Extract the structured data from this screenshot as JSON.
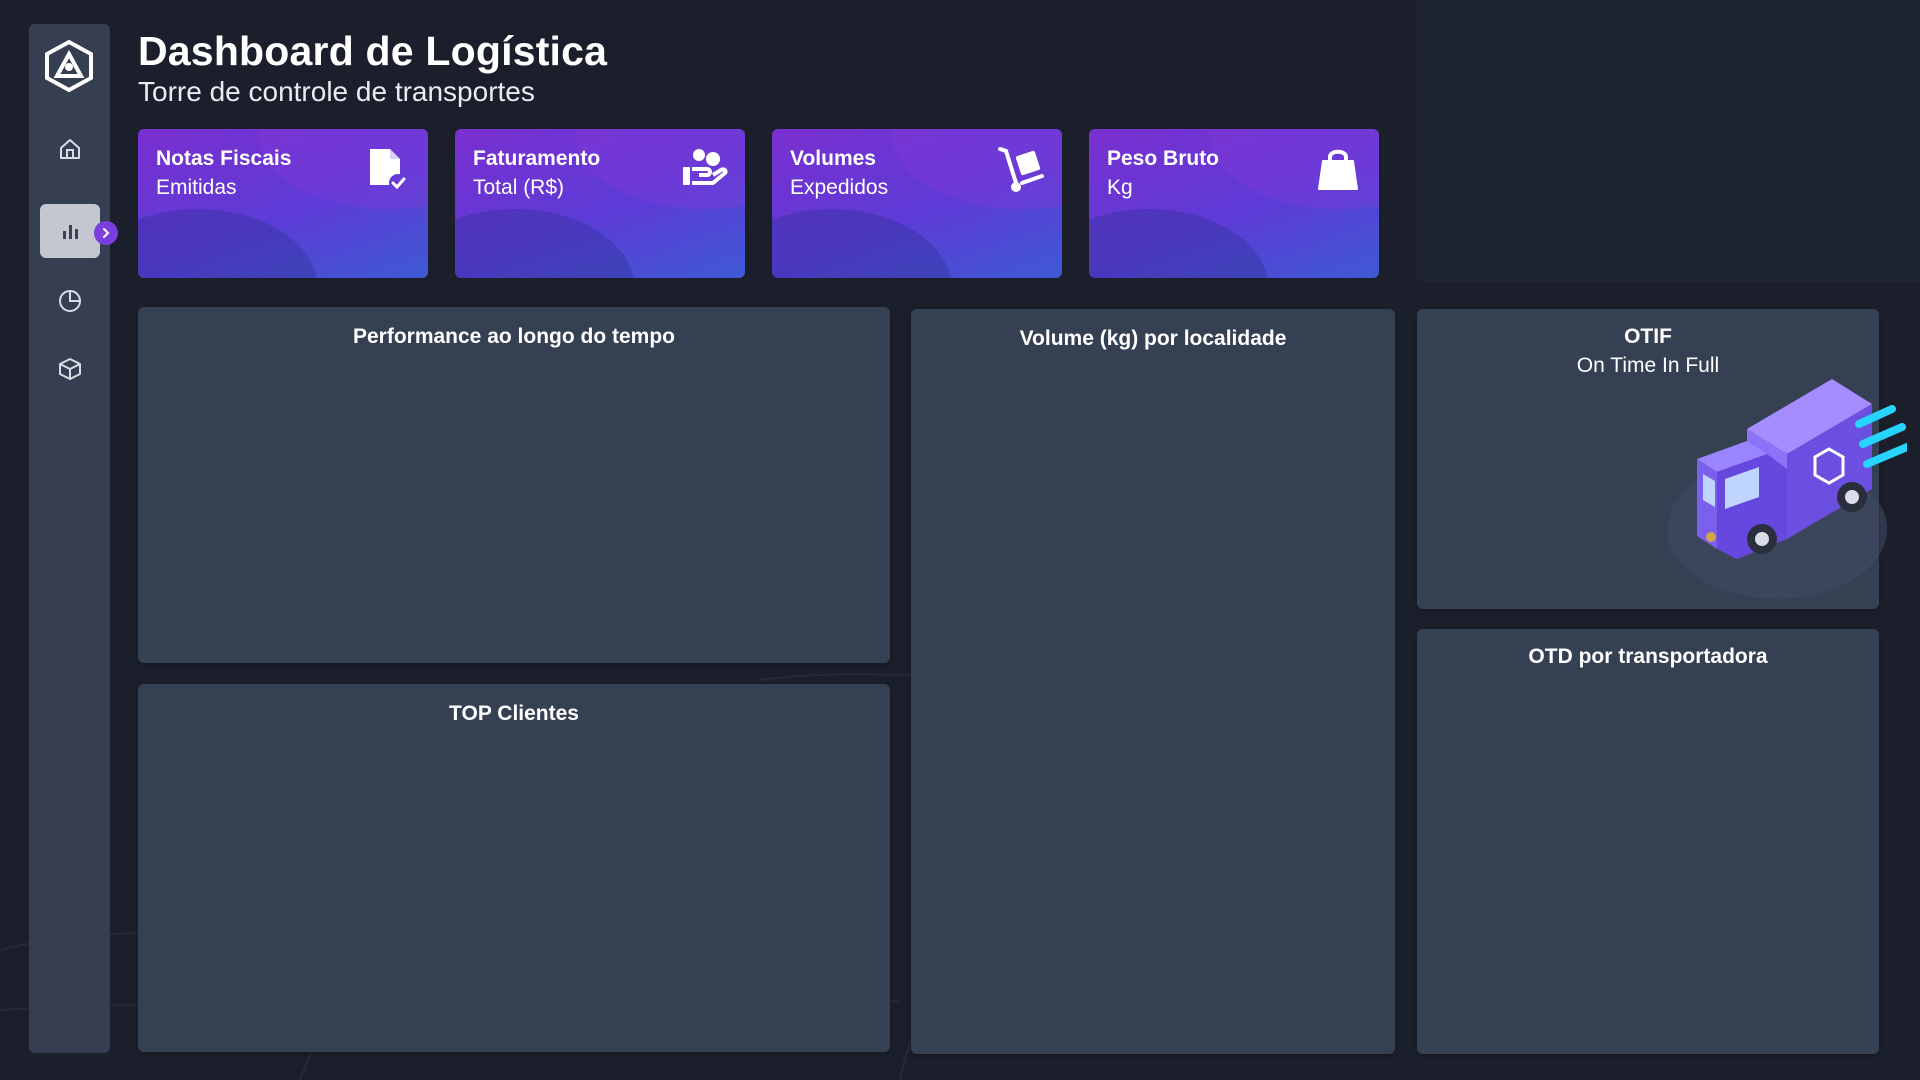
{
  "header": {
    "title": "Dashboard de Logística",
    "subtitle": "Torre de controle de transportes"
  },
  "sidebar": {
    "items": [
      {
        "icon": "home-icon"
      },
      {
        "icon": "bar-chart-icon",
        "active": true
      },
      {
        "icon": "pie-chart-icon"
      },
      {
        "icon": "box-icon"
      }
    ],
    "expand_icon": "chevron-right-icon"
  },
  "kpis": [
    {
      "line1": "Notas Fiscais",
      "line2": "Emitidas",
      "icon": "document-check-icon"
    },
    {
      "line1": "Faturamento",
      "line2": "Total (R$)",
      "icon": "hand-money-icon"
    },
    {
      "line1": "Volumes",
      "line2": "Expedidos",
      "icon": "hand-truck-icon"
    },
    {
      "line1": "Peso Bruto",
      "line2": "Kg",
      "icon": "shopping-bag-icon"
    }
  ],
  "panels": {
    "performance": {
      "title": "Performance ao longo do tempo"
    },
    "volume": {
      "title": "Volume (kg) por localidade"
    },
    "otif": {
      "title": "OTIF",
      "subtitle": "On Time In Full"
    },
    "top_clientes": {
      "title": "TOP Clientes"
    },
    "otd": {
      "title": "OTD por transportadora"
    }
  },
  "colors": {
    "background": "#1b1f2b",
    "panel": "#364053",
    "sidebar": "#363f51",
    "accent_purple": "#7a2fd0",
    "accent_blue": "#3e5ad4"
  }
}
